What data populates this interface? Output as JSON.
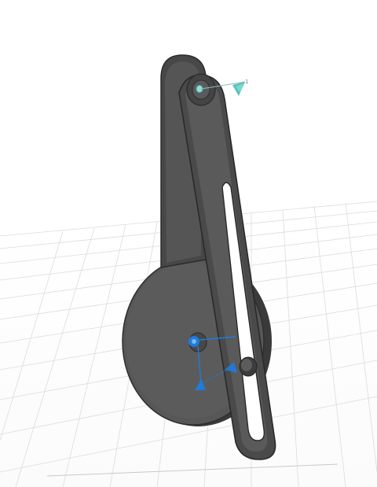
{
  "scene": {
    "description_type": "3d-cad-viewport",
    "colors": {
      "background": "#ffffff",
      "grid": "#d9d9d9",
      "body_dark": "#3d3d3d",
      "body_mid": "#4f4f4f",
      "body_light": "#626262",
      "joint_blue": "#1f7bdc",
      "joint_teal": "#38b8b0"
    }
  },
  "joint_top": {
    "label": "1",
    "icon": "revolute-joint-icon"
  },
  "joint_bottom": {
    "icon": "joint-triad-icon"
  }
}
